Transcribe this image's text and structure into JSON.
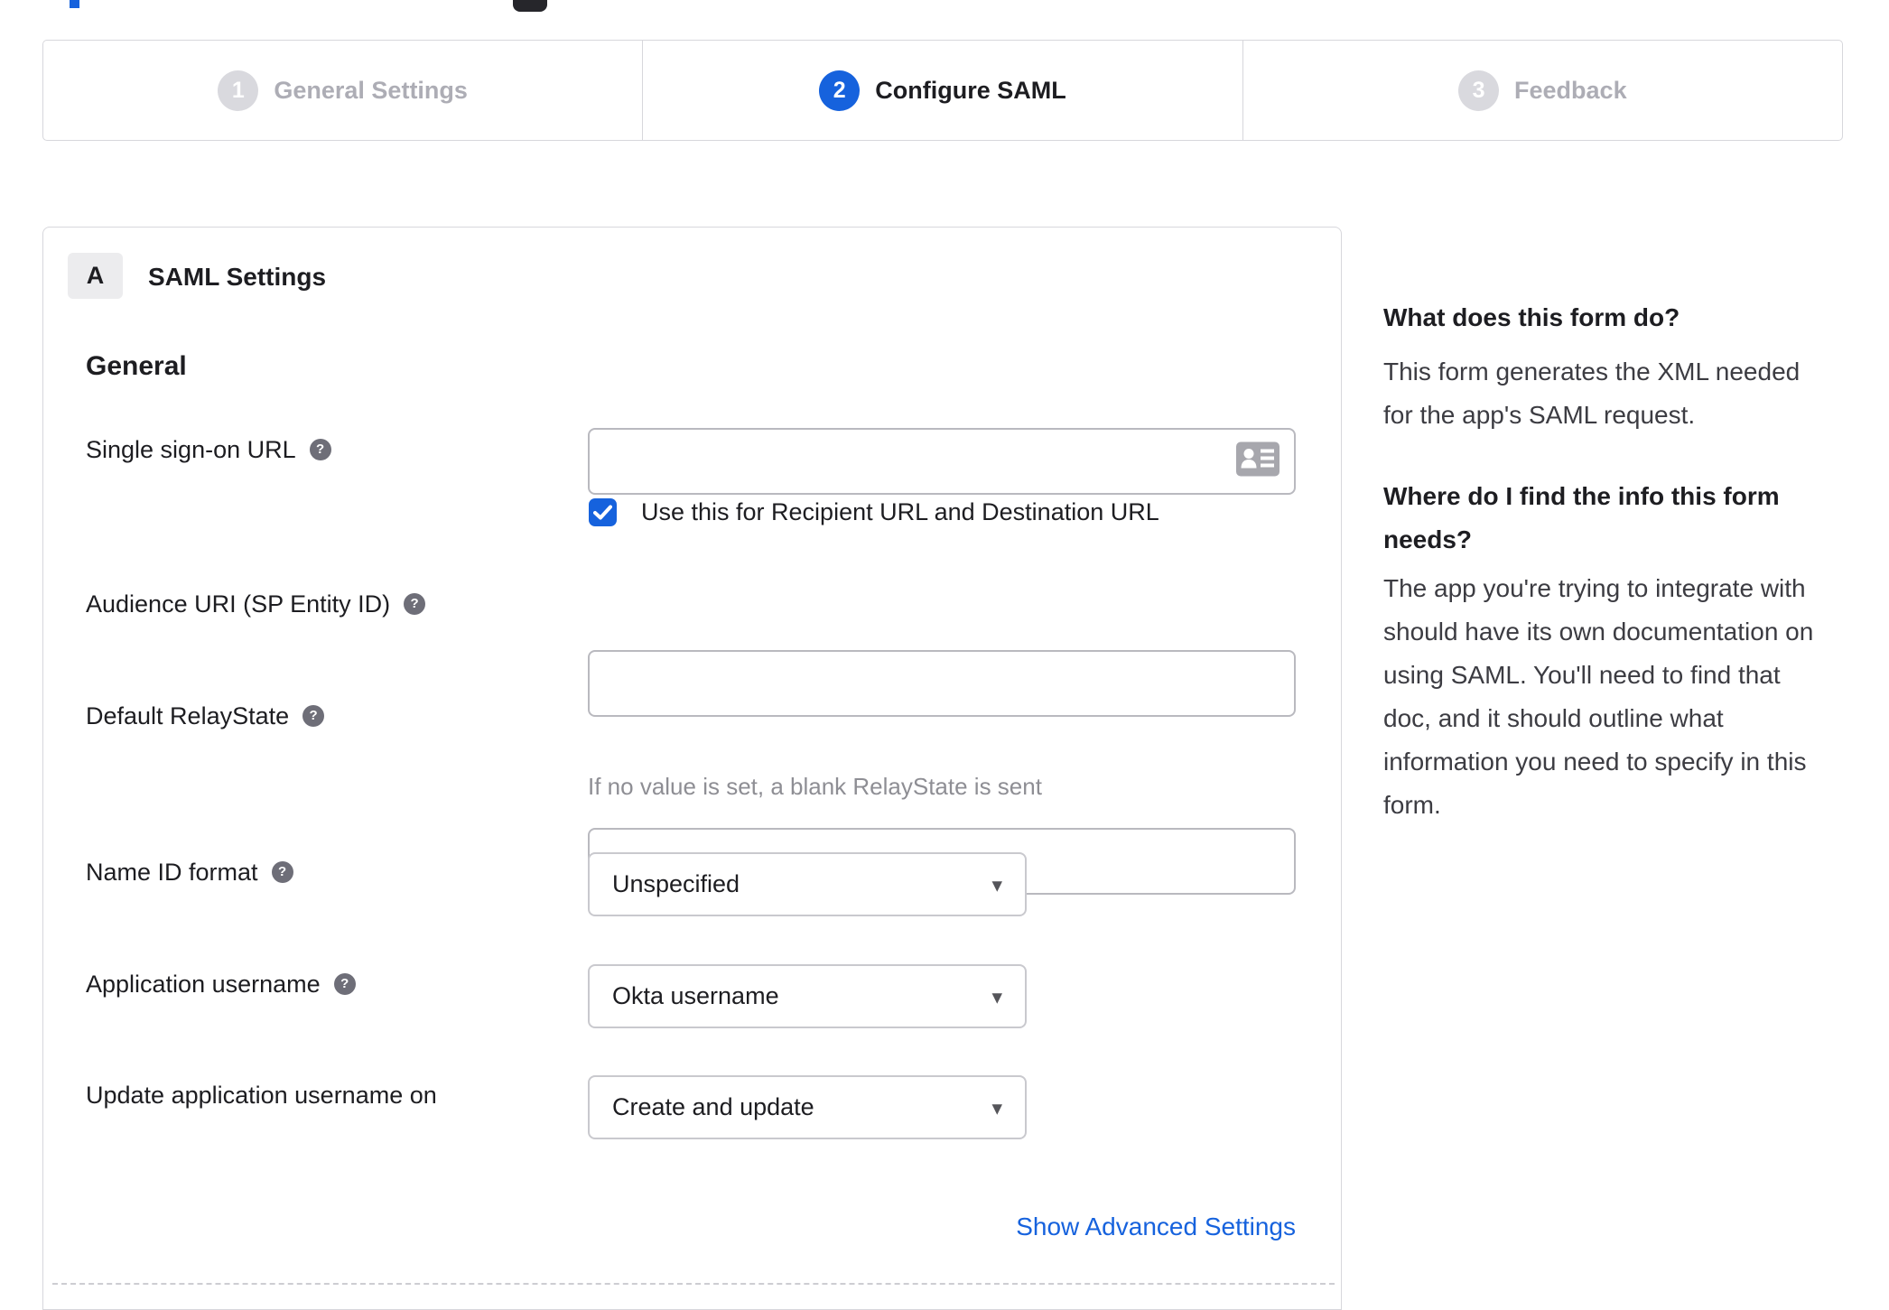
{
  "stepper": {
    "steps": [
      {
        "number": "1",
        "label": "General Settings",
        "active": false
      },
      {
        "number": "2",
        "label": "Configure SAML",
        "active": true
      },
      {
        "number": "3",
        "label": "Feedback",
        "active": false
      }
    ]
  },
  "panel": {
    "badge": "A",
    "title": "SAML Settings",
    "section": "General",
    "fields": {
      "sso_url": {
        "label": "Single sign-on URL",
        "value": ""
      },
      "sso_use_for": {
        "label": "Use this for Recipient URL and Destination URL",
        "checked": true
      },
      "audience_uri": {
        "label": "Audience URI (SP Entity ID)",
        "value": ""
      },
      "default_relaystate": {
        "label": "Default RelayState",
        "value": "",
        "helper": "If no value is set, a blank RelayState is sent"
      },
      "name_id_format": {
        "label": "Name ID format",
        "value": "Unspecified"
      },
      "application_username": {
        "label": "Application username",
        "value": "Okta username"
      },
      "update_application_username_on": {
        "label": "Update application username on",
        "value": "Create and update"
      }
    },
    "advanced_settings_link": "Show Advanced Settings"
  },
  "sidebar": {
    "blocks": [
      {
        "heading_lines": [
          "What does this form do?"
        ],
        "body_lines": [
          "This form generates the XML needed",
          "for the app's SAML request."
        ]
      },
      {
        "heading_lines": [
          "Where do I find the info this form",
          "needs?"
        ],
        "body_lines": [
          "The app you're trying to integrate with",
          "should have its own documentation on",
          "using SAML. You'll need to find that",
          "doc, and it should outline what",
          "information you need to specify in this",
          "form."
        ]
      }
    ]
  },
  "icons": {
    "help_glyph": "?",
    "dropdown_glyph": "▾"
  },
  "colors": {
    "accent": "#1662dd",
    "text_dark": "#1d1d21",
    "text_gray": "#8e8e94",
    "step_inactive": "#adadb5",
    "border": "#d7d7dc"
  }
}
